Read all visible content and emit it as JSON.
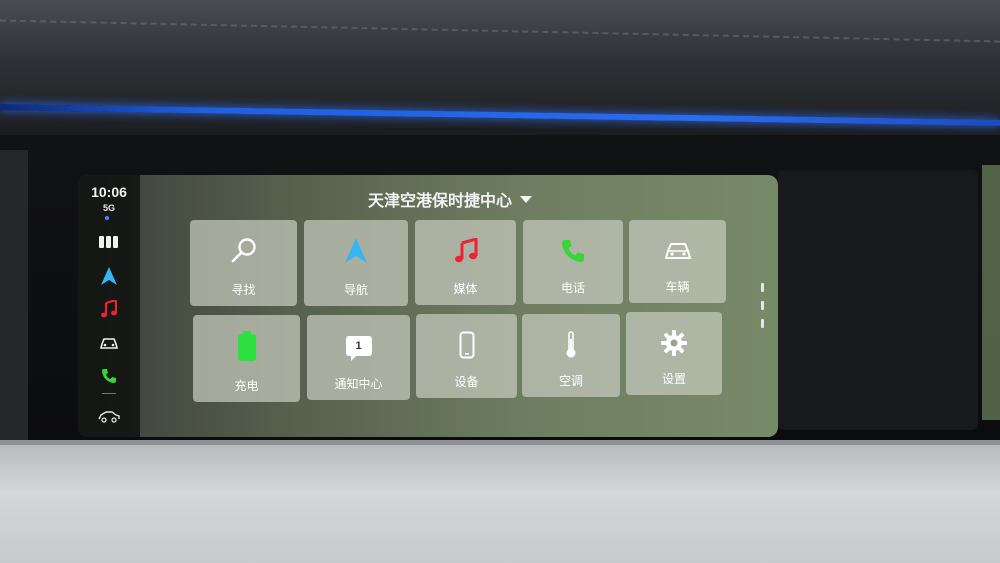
{
  "status": {
    "time": "10:06",
    "network": "5G"
  },
  "header": {
    "location": "天津空港保时捷中心"
  },
  "sidebar": {
    "items": [
      {
        "icon": "apps-grid-icon"
      },
      {
        "icon": "navigation-arrow-icon"
      },
      {
        "icon": "music-note-icon"
      },
      {
        "icon": "car-icon"
      },
      {
        "icon": "phone-icon"
      },
      {
        "icon": "car-profile-icon"
      }
    ]
  },
  "tiles": [
    {
      "label": "寻找",
      "icon": "search-icon"
    },
    {
      "label": "导航",
      "icon": "navigation-arrow-icon"
    },
    {
      "label": "媒体",
      "icon": "music-note-icon"
    },
    {
      "label": "电话",
      "icon": "phone-icon"
    },
    {
      "label": "车辆",
      "icon": "car-icon"
    },
    {
      "label": "充电",
      "icon": "battery-icon"
    },
    {
      "label": "通知中心",
      "icon": "notification-badge-icon",
      "badge": "1"
    },
    {
      "label": "设备",
      "icon": "smartphone-icon"
    },
    {
      "label": "空调",
      "icon": "thermometer-icon"
    },
    {
      "label": "设置",
      "icon": "gear-icon"
    }
  ],
  "colors": {
    "nav_blue": "#35b7f5",
    "media_red": "#ee2233",
    "phone_green": "#36d63a",
    "battery_green": "#2ee040"
  }
}
